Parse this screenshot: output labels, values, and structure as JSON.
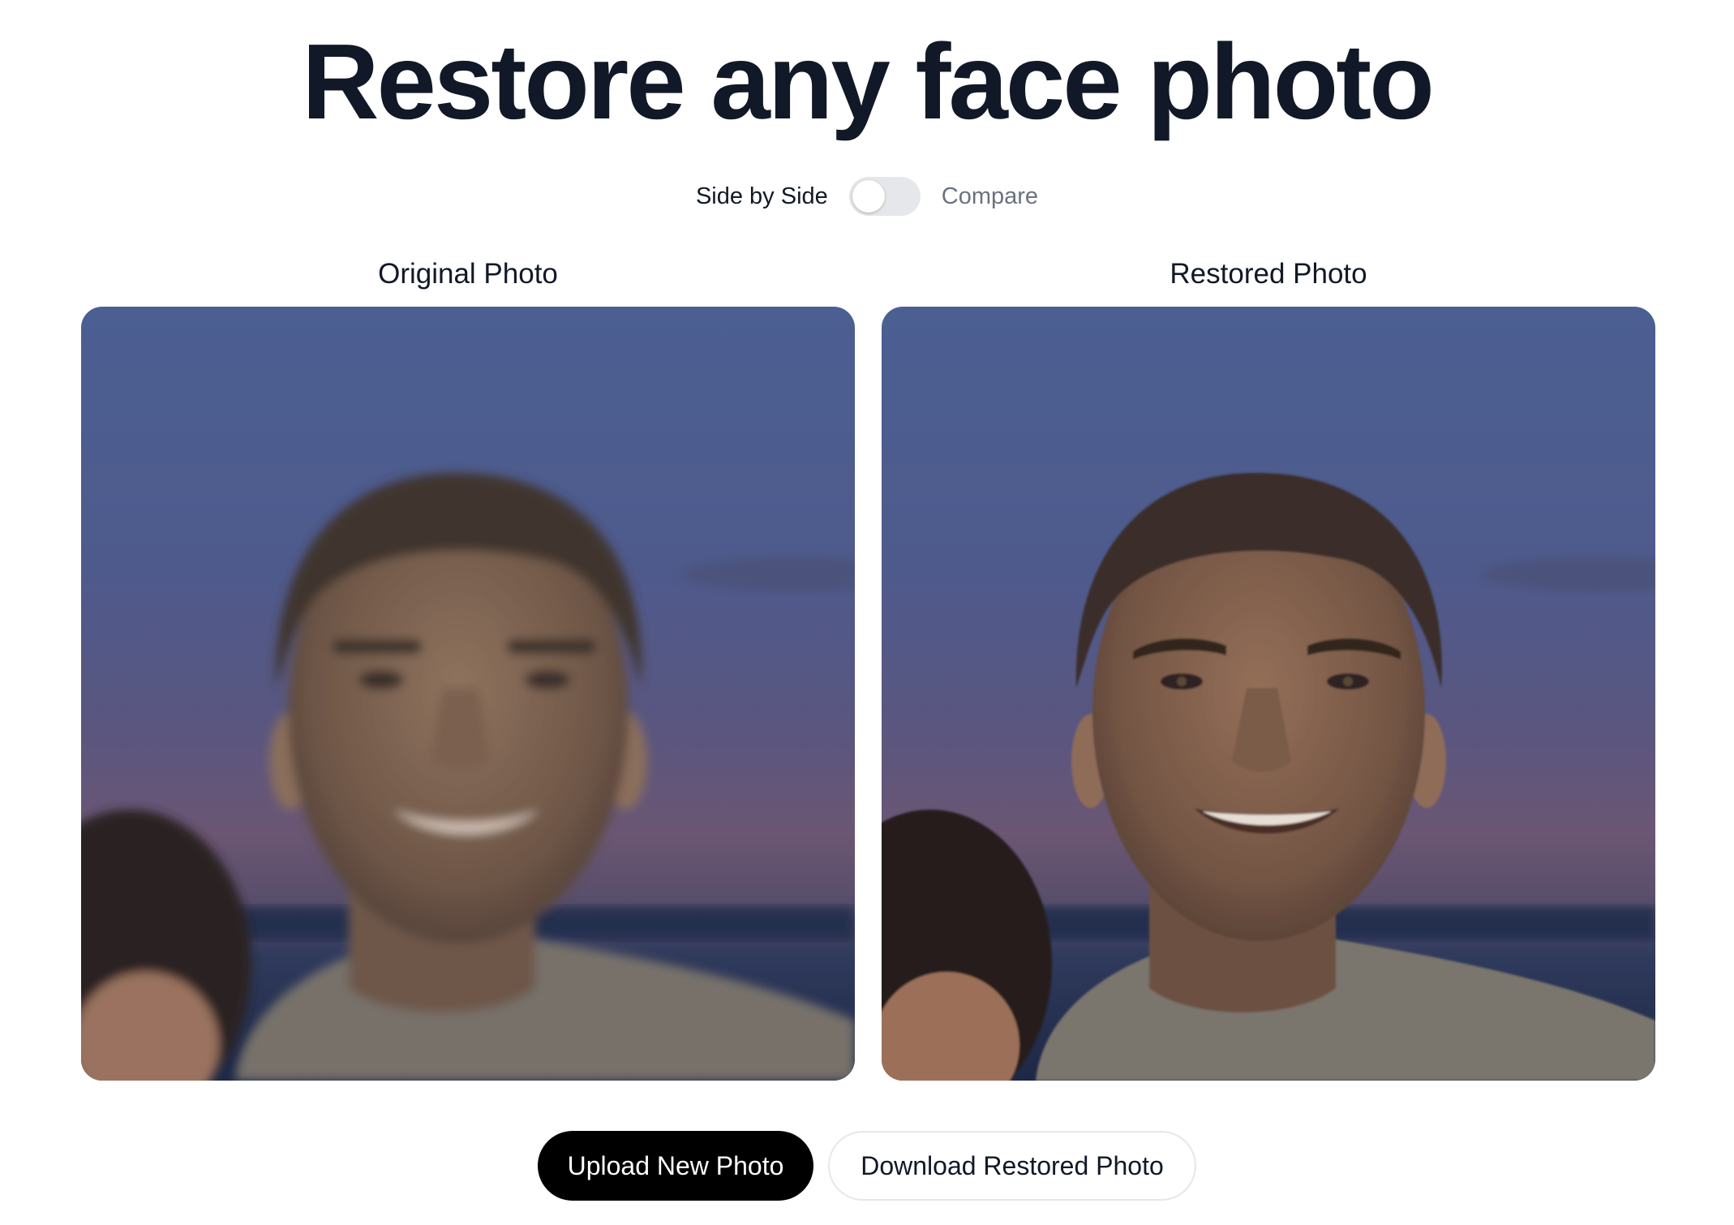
{
  "header": {
    "title": "Restore any face photo"
  },
  "view_toggle": {
    "left_label": "Side by Side",
    "right_label": "Compare",
    "state": "side-by-side"
  },
  "panels": {
    "original": {
      "heading": "Original Photo"
    },
    "restored": {
      "heading": "Restored Photo"
    }
  },
  "actions": {
    "upload_label": "Upload New Photo",
    "download_label": "Download Restored Photo"
  },
  "colors": {
    "title": "#111827",
    "primary_button": "#000000",
    "toggle_track": "#e5e7eb"
  }
}
